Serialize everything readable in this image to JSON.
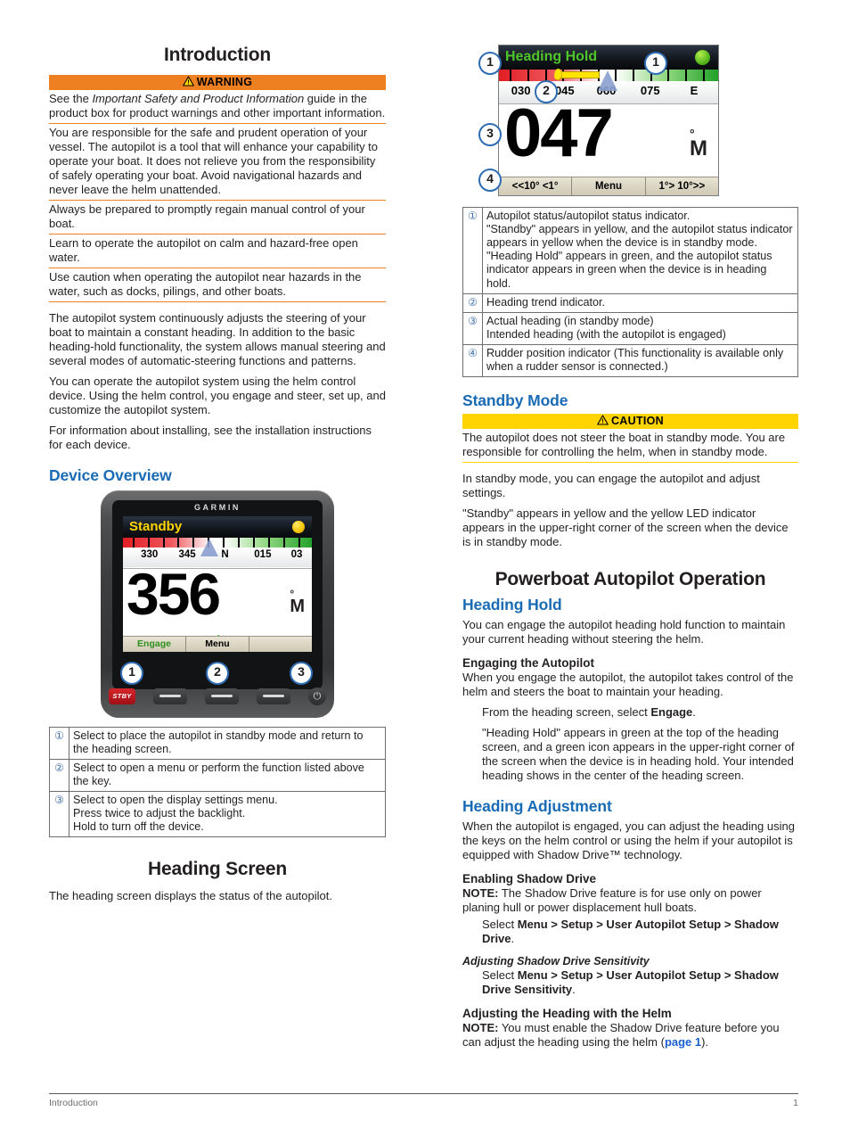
{
  "page": {
    "footer_left": "Introduction",
    "footer_right": "1"
  },
  "left_column": {
    "chapter_title": "Introduction",
    "warning": {
      "bar_label": "WARNING",
      "items": [
        "See the Important Safety and Product Information guide in the product box for product warnings and other important information.",
        "You are responsible for the safe and prudent operation of your vessel. The autopilot is a tool that will enhance your capability to operate your boat. It does not relieve you from the responsibility of safely operating your boat. Avoid navigational hazards and never leave the helm unattended.",
        "Always be prepared to promptly regain manual control of your boat.",
        "Learn to operate the autopilot on calm and hazard-free open water.",
        "Use caution when operating the autopilot near hazards in the water, such as docks, pilings, and other boats."
      ],
      "item1_pre": "See the ",
      "item1_italic": "Important Safety and Product Information",
      "item1_post": " guide in the product box for product warnings and other important information."
    },
    "intro_paragraphs": [
      "The autopilot system continuously adjusts the steering of your boat to maintain a constant heading. In addition to the basic heading-hold functionality, the system allows manual steering and several modes of automatic-steering functions and patterns.",
      "You can operate the autopilot system using the helm control device. Using the helm control, you engage and steer, set up, and customize the autopilot system.",
      "For information about installing, see the installation instructions for each device."
    ],
    "device_overview_title": "Device Overview",
    "device_photo": {
      "brand": "GARMIN",
      "status": "Standby",
      "status_color": "#ffd400",
      "led_color": "#f5c400",
      "ribbon_labels": [
        "330",
        "345",
        "N",
        "015",
        "03"
      ],
      "heading_value": "356",
      "degree_symbol": "°",
      "unit": "M",
      "softkeys": [
        "Engage",
        "Menu",
        ""
      ],
      "engage_color": "#2f8f1e",
      "markers": [
        "1",
        "2",
        "3"
      ],
      "stby_button_label": "STBY",
      "power_icon": "power-icon"
    },
    "device_callouts": [
      {
        "num": "①",
        "lines": [
          "Select to place the autopilot in standby mode and return to the heading screen."
        ]
      },
      {
        "num": "②",
        "lines": [
          "Select to open a menu or perform the function listed above the key."
        ]
      },
      {
        "num": "③",
        "lines": [
          "Select to open the display settings menu.",
          "Press twice to adjust the backlight.",
          "Hold to turn off the device."
        ]
      }
    ],
    "heading_screen_title": "Heading Screen",
    "heading_screen_text": "The heading screen displays the status of the autopilot."
  },
  "right_column": {
    "heading_photo": {
      "status": "Heading Hold",
      "status_color": "#4fc52b",
      "led_color": "#57b81c",
      "ribbon_labels": [
        "030",
        "045",
        "060",
        "075",
        "E"
      ],
      "heading_value": "047",
      "degree_symbol": "°",
      "unit": "M",
      "softkeys": [
        "<<10°  <1°",
        "Menu",
        "1°>  10°>>"
      ],
      "markers": [
        "1",
        "2",
        "3",
        "4"
      ]
    },
    "heading_callouts": [
      {
        "num": "①",
        "lines": [
          "Autopilot status/autopilot status indicator.",
          "\"Standby\" appears in yellow, and the autopilot status indicator appears in yellow when the device is in standby mode.",
          "\"Heading Hold\" appears in green, and the autopilot status indicator appears in green when the device is in heading hold."
        ]
      },
      {
        "num": "②",
        "lines": [
          "Heading trend indicator."
        ]
      },
      {
        "num": "③",
        "lines": [
          "Actual heading (in standby mode)",
          "Intended heading (with the autopilot is engaged)"
        ]
      },
      {
        "num": "④",
        "lines": [
          "Rudder position indicator (This functionality is available only when a rudder sensor is connected.)"
        ]
      }
    ],
    "standby_mode_title": "Standby Mode",
    "caution": {
      "bar_label": "CAUTION",
      "items": [
        "The autopilot does not steer the boat in standby mode. You are responsible for controlling the helm, when in standby mode."
      ]
    },
    "standby_paragraphs": [
      "In standby mode, you can engage the autopilot and adjust settings.",
      "\"Standby\" appears in yellow and the yellow LED indicator appears in the upper-right corner of the screen when the device is in standby mode."
    ],
    "powerboat_title": "Powerboat Autopilot Operation",
    "heading_hold_title": "Heading Hold",
    "heading_hold_text": "You can engage the autopilot heading hold function to maintain your current heading without steering the helm.",
    "engaging_title": "Engaging the Autopilot",
    "engaging_text": "When you engage the autopilot, the autopilot takes control of the helm and steers the boat to maintain your heading.",
    "engaging_step_pre": "From the heading screen, select ",
    "engaging_step_bold": "Engage",
    "engaging_step_post": ".",
    "engaging_result": "\"Heading Hold\" appears in green at the top of the heading screen, and a green icon appears in the upper-right corner of the screen when the device is in heading hold. Your intended heading shows in the center of the heading screen.",
    "heading_adjustment_title": "Heading Adjustment",
    "heading_adjustment_text": "When the autopilot is engaged, you can adjust the heading using the keys on the helm control or using the helm if your autopilot is equipped with Shadow Drive™ technology.",
    "enabling_shadow_title": "Enabling Shadow Drive",
    "enabling_note_label": "NOTE:",
    "enabling_note_text": " The Shadow Drive feature is for use only on power planing hull or power displacement hull boats.",
    "enabling_step_pre": "Select ",
    "enabling_step_path": "Menu > Setup > User Autopilot Setup > Shadow Drive",
    "enabling_step_post": ".",
    "sensitivity_title": "Adjusting Shadow Drive Sensitivity",
    "sensitivity_step_pre": "Select ",
    "sensitivity_step_path": "Menu > Setup > User Autopilot Setup > Shadow Drive Sensitivity",
    "sensitivity_step_post": ".",
    "helm_title": "Adjusting the Heading with the Helm",
    "helm_note_label": "NOTE:",
    "helm_note_pre": " You must enable the Shadow Drive feature before you can adjust the heading using the helm (",
    "helm_note_link": "page 1",
    "helm_note_post": ")."
  }
}
